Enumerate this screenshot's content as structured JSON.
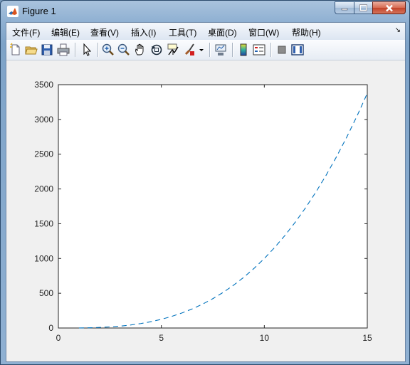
{
  "window": {
    "title": "Figure 1"
  },
  "menu": [
    "文件(F)",
    "编辑(E)",
    "查看(V)",
    "插入(I)",
    "工具(T)",
    "桌面(D)",
    "窗口(W)",
    "帮助(H)"
  ],
  "menu_overflow": "↘",
  "toolbar": [
    "new-figure-icon",
    "open-file-icon",
    "save-icon",
    "print-icon",
    "select-arrow-icon",
    "zoom-in-icon",
    "zoom-out-icon",
    "pan-hand-icon",
    "rotate-3d-icon",
    "data-cursor-icon",
    "brush-icon",
    "brush-dropdown-icon",
    "link-plot-icon",
    "colorbar-icon",
    "legend-icon",
    "hide-plot-tools-icon",
    "show-plot-tools-icon"
  ],
  "chart_data": {
    "type": "line",
    "line_style": "dashed",
    "color": "#0072BD",
    "x": [
      1,
      1.5,
      2,
      2.5,
      3,
      3.5,
      4,
      4.5,
      5,
      5.5,
      6,
      6.5,
      7,
      7.5,
      8,
      8.5,
      9,
      9.5,
      10,
      10.5,
      11,
      11.5,
      12,
      12.5,
      13,
      13.5,
      14,
      14.5,
      15
    ],
    "y": [
      1,
      3.4,
      8,
      15.6,
      27,
      42.9,
      64,
      91.1,
      125,
      166.4,
      216,
      274.6,
      343,
      421.9,
      512,
      614.1,
      729,
      857.4,
      1000,
      1157.6,
      1331,
      1520.9,
      1728,
      1953.1,
      2197,
      2460.4,
      2744,
      3048.6,
      3375
    ],
    "xlim": [
      0,
      15
    ],
    "ylim": [
      0,
      3500
    ],
    "xticks": [
      0,
      5,
      10,
      15
    ],
    "yticks": [
      0,
      500,
      1000,
      1500,
      2000,
      2500,
      3000,
      3500
    ],
    "grid": false,
    "title": "",
    "xlabel": "",
    "ylabel": ""
  }
}
